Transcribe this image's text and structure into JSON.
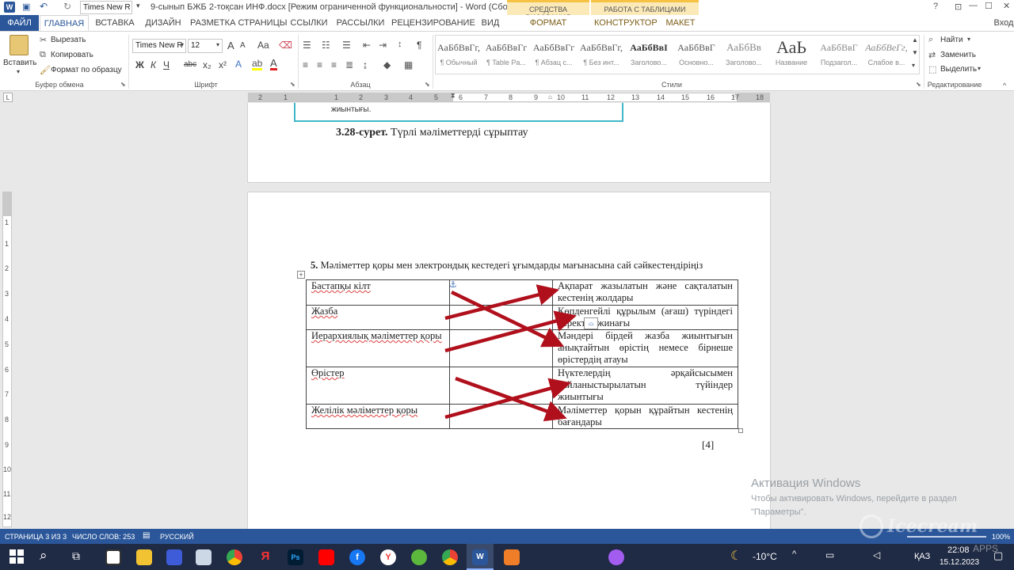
{
  "window": {
    "title": "9-сынып БЖБ 2-тоқсан ИНФ.docx [Режим ограниченной функциональности] - Word (Сбой ак...",
    "font_name": "Times New R",
    "context_tabs": [
      "СРЕДСТВА РИСОВАНИЯ",
      "РАБОТА С ТАБЛИЦАМИ"
    ],
    "controls": [
      "?",
      "⊡",
      "—",
      "☐",
      "✕"
    ],
    "login": "Вход"
  },
  "tabs": {
    "file": "ФАЙЛ",
    "home": "ГЛАВНАЯ",
    "insert": "ВСТАВКА",
    "design": "ДИЗАЙН",
    "layout": "РАЗМЕТКА СТРАНИЦЫ",
    "refs": "ССЫЛКИ",
    "mail": "РАССЫЛКИ",
    "review": "РЕЦЕНЗИРОВАНИЕ",
    "view": "ВИД",
    "format": "ФОРМАТ",
    "constructor": "КОНСТРУКТОР",
    "maket": "МАКЕТ"
  },
  "ribbon": {
    "clipboard": {
      "paste": "Вставить",
      "cut": "Вырезать",
      "copy": "Копировать",
      "format_painter": "Формат по образцу",
      "label": "Буфер обмена"
    },
    "font": {
      "name": "Times New R",
      "size": "12",
      "label": "Шрифт",
      "bold": "Ж",
      "italic": "К",
      "underline": "Ч",
      "strike": "abc",
      "sub": "x₂",
      "sup": "x²",
      "grow": "A",
      "shrink": "A",
      "case": "Aa",
      "color": "A"
    },
    "paragraph": {
      "label": "Абзац",
      "pilcrow": "¶"
    },
    "styles": {
      "label": "Стили",
      "items": [
        {
          "sample": "АаБбВвГг,",
          "name": "¶ Обычный"
        },
        {
          "sample": "АаБбВвГг",
          "name": "¶ Table Pa..."
        },
        {
          "sample": "АаБбВвГг",
          "name": "¶ Абзац с..."
        },
        {
          "sample": "АаБбВвГг,",
          "name": "¶ Без инт..."
        },
        {
          "sample": "АаБбВвІ",
          "name": "Заголово..."
        },
        {
          "sample": "АаБбВвГ",
          "name": "Основно..."
        },
        {
          "sample": "АаБбВв",
          "name": "Заголово..."
        },
        {
          "sample": "АаЬ",
          "name": "Название"
        },
        {
          "sample": "АаБбВвГ",
          "name": "Подзагол..."
        },
        {
          "sample": "АаБбВеГг,",
          "name": "Слабое в..."
        }
      ]
    },
    "editing": {
      "find": "Найти",
      "replace": "Заменить",
      "select": "Выделить",
      "label": "Редактирование"
    }
  },
  "ruler": {
    "corner": "L",
    "numbers": [
      "2",
      "1",
      "1",
      "2",
      "3",
      "4",
      "5",
      "6",
      "7",
      "8",
      "9",
      "10",
      "11",
      "12",
      "13",
      "14",
      "15",
      "16",
      "17",
      "18"
    ],
    "vertical": [
      "1",
      "1",
      "2",
      "3",
      "4",
      "5",
      "6",
      "7",
      "8",
      "9",
      "10",
      "11",
      "12"
    ]
  },
  "page1": {
    "frame_text": "жиынтығы.",
    "caption_bold": "3.28-сурет.",
    "caption_rest": "Түрлі мәліметтерді сұрыптау"
  },
  "page2": {
    "question_num": "5.",
    "question": "Мәліметтер қоры мен электрондық кестедегі ұғымдарды мағынасына сай сәйкестендіріңіз",
    "rows": [
      {
        "left": "Бастапқы кілт",
        "right": "Ақпарат жазылатын және сақталатын кестенің жолдары"
      },
      {
        "left": "Жазба",
        "right": "Көпденгейлі құрылым (ағаш) түріндегі деректер жинағы"
      },
      {
        "left": "Иерархиялық мәліметтер қоры",
        "right": "Мәндері бірдей жазба жиынтығын анықтайтын өрістің немесе бірнеше өрістердің атауы"
      },
      {
        "left": "Өрістер",
        "right": "Нүктелердің әрқайсысымен байланыстырылатын түйіндер жиынтығы"
      },
      {
        "left": "Желілік мәліметтер қоры",
        "right": "Мәліметтер қорын құрайтын кестенің бағандары"
      }
    ],
    "score": "[4]"
  },
  "watermark": {
    "title": "Активация Windows",
    "line1": "Чтобы активировать Windows, перейдите в раздел",
    "line2": "\"Параметры\"."
  },
  "status": {
    "page": "СТРАНИЦА 3 ИЗ 3",
    "words": "ЧИСЛО СЛОВ: 253",
    "lang": "РУССКИЙ",
    "zoom": "100%"
  },
  "taskbar": {
    "weather": "-10°C",
    "lang": "ҚАЗ",
    "time": "22:08",
    "date": "15.12.2023",
    "icecream": "Icecream",
    "apps": "APPS"
  },
  "colors": {
    "word_blue": "#2b579a",
    "arrow_red": "#b0101c",
    "ctx_drawing": "#f6c244",
    "ctx_table": "#f6c244"
  }
}
